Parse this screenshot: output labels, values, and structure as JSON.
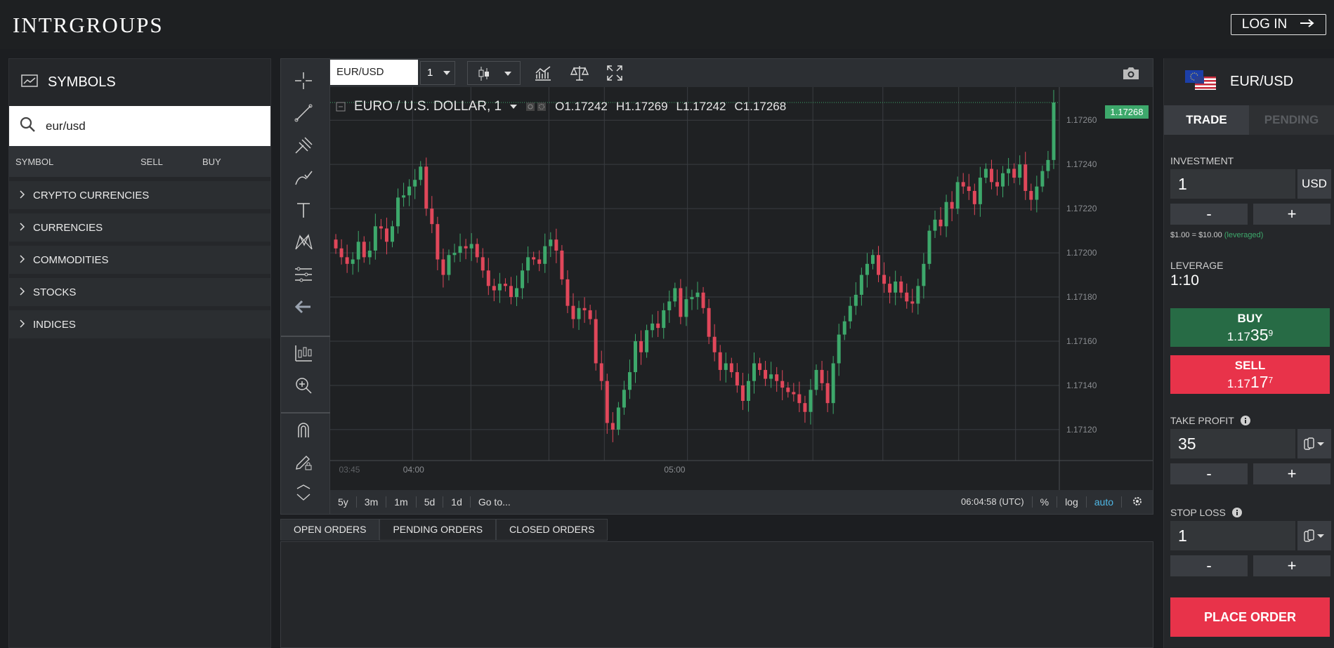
{
  "header": {
    "logo": "INTRGROUPS",
    "login_label": "LOG IN"
  },
  "symbols": {
    "title": "SYMBOLS",
    "search_value": "eur/usd",
    "columns": [
      "SYMBOL",
      "SELL",
      "BUY"
    ],
    "categories": [
      "CRYPTO CURRENCIES",
      "CURRENCIES",
      "COMMODITIES",
      "STOCKS",
      "INDICES"
    ]
  },
  "chart": {
    "symbol_input": "EUR/USD",
    "interval": "1",
    "legend_title": "EURO / U.S. DOLLAR, 1",
    "ohlc": {
      "o": "O1.17242",
      "h": "H1.17269",
      "l": "L1.17242",
      "c": "C1.17268"
    },
    "last_price": "1.17268",
    "timeframes": [
      "5y",
      "3m",
      "1m",
      "5d",
      "1d",
      "Go to..."
    ],
    "clock": "06:04:58 (UTC)",
    "percent_label": "%",
    "log_label": "log",
    "auto_label": "auto",
    "colors": {
      "up": "#3da86b",
      "down": "#e0475a",
      "grid": "#3a3d41",
      "accent": "#4fb8e6"
    }
  },
  "chart_data": {
    "type": "candlestick",
    "title": "EURO / U.S. DOLLAR, 1",
    "x_ticks": [
      "03:45",
      "04:00",
      "05:00"
    ],
    "y_ticks": [
      1.1726,
      1.1724,
      1.1722,
      1.172,
      1.1718,
      1.1716,
      1.1714,
      1.1712
    ],
    "ylim": [
      1.17106,
      1.17275
    ],
    "grid": true,
    "last": 1.17268,
    "closes": [
      1.17202,
      1.17198,
      1.17195,
      1.17197,
      1.17205,
      1.17198,
      1.17201,
      1.17212,
      1.17211,
      1.17205,
      1.17212,
      1.17225,
      1.17226,
      1.1723,
      1.17233,
      1.17239,
      1.1722,
      1.17213,
      1.17197,
      1.1719,
      1.17199,
      1.172,
      1.17203,
      1.17202,
      1.17204,
      1.17198,
      1.17192,
      1.17185,
      1.17183,
      1.17186,
      1.17185,
      1.1718,
      1.17184,
      1.17192,
      1.17198,
      1.17197,
      1.17195,
      1.17203,
      1.17206,
      1.17201,
      1.17188,
      1.17176,
      1.1717,
      1.17175,
      1.17174,
      1.1717,
      1.1715,
      1.17142,
      1.17123,
      1.1712,
      1.1713,
      1.17138,
      1.17146,
      1.1716,
      1.17155,
      1.17165,
      1.17168,
      1.17166,
      1.17174,
      1.17178,
      1.17184,
      1.17171,
      1.17179,
      1.1718,
      1.17182,
      1.17175,
      1.17162,
      1.17155,
      1.17147,
      1.1715,
      1.17146,
      1.1714,
      1.17133,
      1.17142,
      1.1715,
      1.17147,
      1.17143,
      1.17145,
      1.17142,
      1.17139,
      1.17137,
      1.17136,
      1.17132,
      1.17128,
      1.17138,
      1.17147,
      1.17141,
      1.17132,
      1.1715,
      1.17163,
      1.17169,
      1.17176,
      1.17181,
      1.1719,
      1.17195,
      1.17199,
      1.1719,
      1.17186,
      1.17182,
      1.17187,
      1.17182,
      1.17178,
      1.17177,
      1.17185,
      1.17195,
      1.1721,
      1.17215,
      1.17212,
      1.17223,
      1.1722,
      1.17232,
      1.1723,
      1.17228,
      1.17222,
      1.17234,
      1.17238,
      1.17232,
      1.1723,
      1.17236,
      1.17238,
      1.17234,
      1.1724,
      1.17228,
      1.17224,
      1.1723,
      1.17237,
      1.17242,
      1.17268
    ]
  },
  "orders": {
    "tabs": [
      "OPEN ORDERS",
      "PENDING ORDERS",
      "CLOSED ORDERS"
    ]
  },
  "trade": {
    "pair": "EUR/USD",
    "tabs": [
      "TRADE",
      "PENDING"
    ],
    "investment_label": "INVESTMENT",
    "investment_value": "1",
    "currency": "USD",
    "minus": "-",
    "plus": "+",
    "leverage_note": "$1.00 = $10.00",
    "leverage_note_tag": "(leveraged)",
    "leverage_label": "LEVERAGE",
    "leverage_value": "1:10",
    "buy": {
      "label": "BUY",
      "price_main": "1.17",
      "price_big": "35",
      "price_sup": "9"
    },
    "sell": {
      "label": "SELL",
      "price_main": "1.17",
      "price_big": "17",
      "price_sup": "7"
    },
    "take_profit_label": "TAKE PROFIT",
    "take_profit_value": "35",
    "stop_loss_label": "STOP LOSS",
    "stop_loss_value": "1",
    "place_order": "PLACE ORDER",
    "colors": {
      "buy": "#276b45",
      "sell": "#e8334a",
      "place": "#e8334a"
    }
  }
}
